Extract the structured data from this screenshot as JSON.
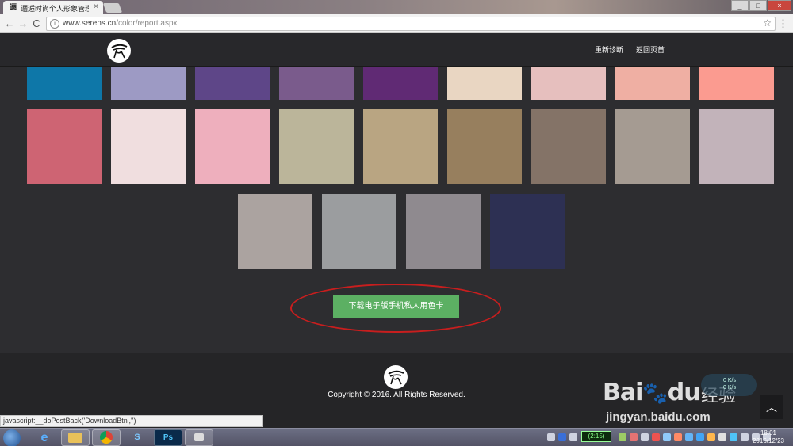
{
  "browser": {
    "tab_title": "逦逅时尚个人形象管理",
    "tab_favicon": "逦",
    "tab_close": "×",
    "url_host": "www.serens.cn",
    "url_path": "/color/report.aspx",
    "back": "←",
    "forward": "→",
    "reload": "C",
    "bookmark": "☆",
    "menu": "⋮",
    "page_icon": "i",
    "win_min": "_",
    "win_max": "□",
    "win_close": "×"
  },
  "header": {
    "logo_icon": "serens-logo",
    "nav": [
      "重新诊断",
      "返回页首"
    ]
  },
  "palette": {
    "row1": [
      "#0e77a8",
      "#9d9ac4",
      "#5e4688",
      "#7a5b8c",
      "#602a74",
      "#e9d6c2",
      "#e6bfbe",
      "#efafa3",
      "#fb9b90"
    ],
    "row2": [
      "#ce6473",
      "#f0dedf",
      "#eeafbd",
      "#bbb59a",
      "#b9a582",
      "#977f5e",
      "#847367",
      "#a59b92",
      "#c2b3ba"
    ],
    "row3": [
      "#aba3a0",
      "#9b9d9f",
      "#8f8a8f",
      "#2d3053"
    ]
  },
  "main": {
    "download_button": "下载电子版手机私人用色卡",
    "annotation_color": "#c81e1e"
  },
  "footer": {
    "copyright": "Copyright © 2016. All Rights Reserved.",
    "back_to_top": "︿"
  },
  "watermark": {
    "brand": "Bai",
    "brand_tail": "du",
    "jingyan": "经验",
    "url": "jingyan.baidu.com",
    "speed_up": "0 K/s",
    "speed_down": "0 K/s"
  },
  "status_bar": {
    "text": "javascript:__doPostBack('DownloadBtn','')"
  },
  "taskbar": {
    "apps": [
      "e",
      "",
      "",
      "S",
      "Ps",
      ""
    ],
    "battery": "(2:15)",
    "time": "18:01",
    "date": "2016/12/23"
  }
}
